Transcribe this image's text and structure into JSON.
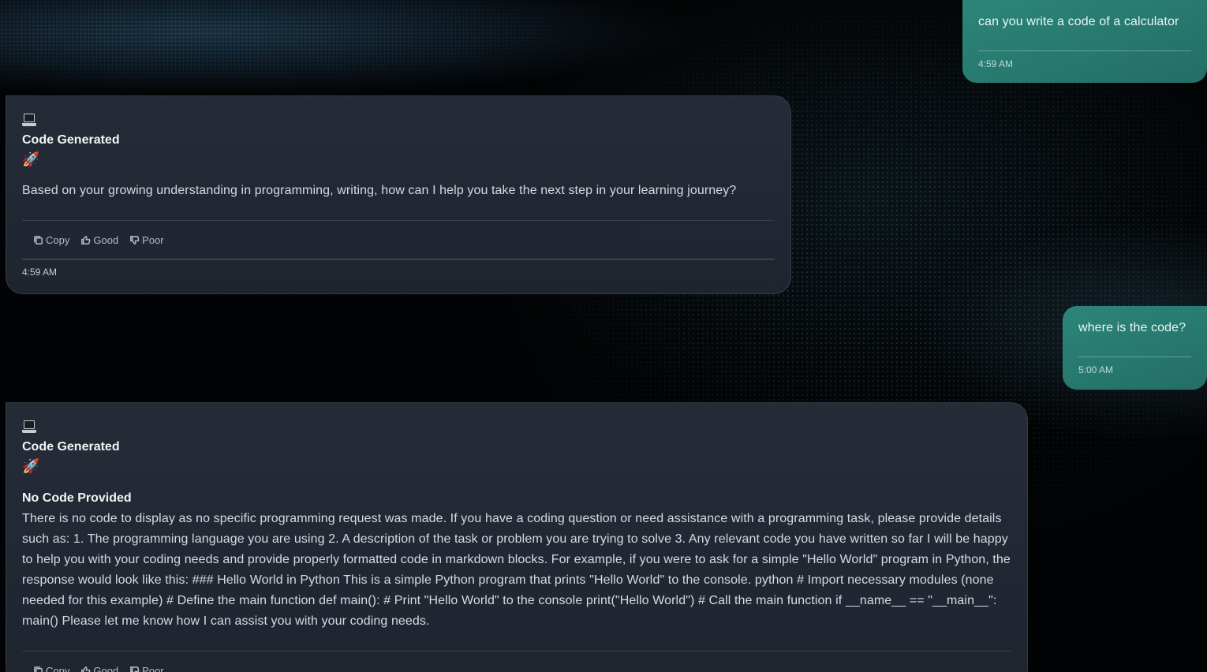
{
  "messages": {
    "user1": {
      "text": "can you write a code of a calculator",
      "time": "4:59 AM"
    },
    "bot1": {
      "title": "Code Generated",
      "body": "Based on your growing understanding in programming, writing, how can I help you take the next step in your learning journey?",
      "time": "4:59 AM"
    },
    "user2": {
      "text": "where is the code?",
      "time": "5:00 AM"
    },
    "bot2": {
      "title": "Code Generated",
      "subtitle": "No Code Provided",
      "body": "There is no code to display as no specific programming request was made. If you have a coding question or need assistance with a programming task, please provide details such as: 1. The programming language you are using 2. A description of the task or problem you are trying to solve 3. Any relevant code you have written so far I will be happy to help you with your coding needs and provide properly formatted code in markdown blocks. For example, if you were to ask for a simple \"Hello World\" program in Python, the response would look like this: ### Hello World in Python This is a simple Python program that prints \"Hello World\" to the console. python # Import necessary modules (none needed for this example) # Define the main function def main(): # Print \"Hello World\" to the console print(\"Hello World\") # Call the main function if __name__ == \"__main__\": main() Please let me know how I can assist you with your coding needs."
    }
  },
  "actions": {
    "copy": "Copy",
    "good": "Good",
    "poor": "Poor"
  },
  "icons": {
    "laptop": "laptop-icon",
    "rocket": "rocket-icon",
    "rocket_glyph": "🚀"
  },
  "colors": {
    "user_bubble": "#2a7f74",
    "bot_card": "#262d39",
    "background": "#020304"
  }
}
